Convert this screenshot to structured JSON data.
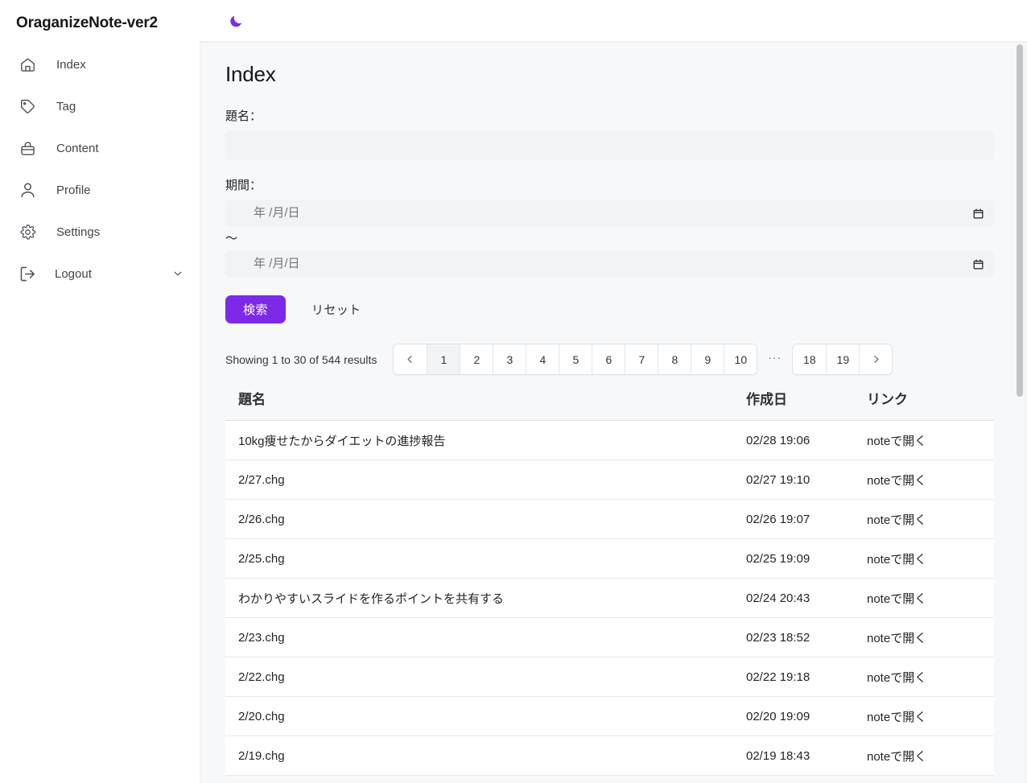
{
  "app": {
    "brand": "OraganizeNote-ver2",
    "accent_color": "#7c2ae8",
    "page_bg": "#f7f8fa",
    "input_bg": "#f1f3f5"
  },
  "sidebar": {
    "items": [
      {
        "label": "Index",
        "icon": "home-icon"
      },
      {
        "label": "Tag",
        "icon": "tag-icon"
      },
      {
        "label": "Content",
        "icon": "briefcase-icon"
      },
      {
        "label": "Profile",
        "icon": "user-icon"
      },
      {
        "label": "Settings",
        "icon": "gear-icon"
      },
      {
        "label": "Logout",
        "icon": "logout-icon",
        "trailing_icon": "chevron-down-icon"
      }
    ]
  },
  "topbar": {
    "theme_toggle_icon": "moon-icon"
  },
  "main": {
    "title": "Index",
    "form": {
      "title_label": "題名：",
      "title_value": "",
      "title_placeholder": "",
      "period_label": "期間：",
      "date_from_placeholder": "年 /月/日",
      "date_from_value": "",
      "date_to_placeholder": "年 /月/日",
      "date_to_value": "",
      "range_separator": "～",
      "calendar_icon": "calendar-icon",
      "search_button": "検索",
      "reset_button": "リセット"
    },
    "pagination": {
      "summary": "Showing 1 to 30 of 544 results",
      "prev_icon": "chevron-left-icon",
      "next_icon": "chevron-right-icon",
      "ellipsis": "···",
      "pages_left": [
        "1",
        "2",
        "3",
        "4",
        "5",
        "6",
        "7",
        "8",
        "9",
        "10"
      ],
      "pages_right": [
        "18",
        "19"
      ],
      "current_page": "1"
    },
    "table": {
      "columns": [
        "題名",
        "作成日",
        "リンク"
      ],
      "rows": [
        {
          "title": "10kg痩せたからダイエットの進捗報告",
          "date": "02/28 19:06",
          "link": "noteで開く"
        },
        {
          "title": "2/27.chg",
          "date": "02/27 19:10",
          "link": "noteで開く"
        },
        {
          "title": "2/26.chg",
          "date": "02/26 19:07",
          "link": "noteで開く"
        },
        {
          "title": "2/25.chg",
          "date": "02/25 19:09",
          "link": "noteで開く"
        },
        {
          "title": "わかりやすいスライドを作るポイントを共有する",
          "date": "02/24 20:43",
          "link": "noteで開く"
        },
        {
          "title": "2/23.chg",
          "date": "02/23 18:52",
          "link": "noteで開く"
        },
        {
          "title": "2/22.chg",
          "date": "02/22 19:18",
          "link": "noteで開く"
        },
        {
          "title": "2/20.chg",
          "date": "02/20 19:09",
          "link": "noteで開く"
        },
        {
          "title": "2/19.chg",
          "date": "02/19 18:43",
          "link": "noteで開く"
        }
      ]
    }
  }
}
